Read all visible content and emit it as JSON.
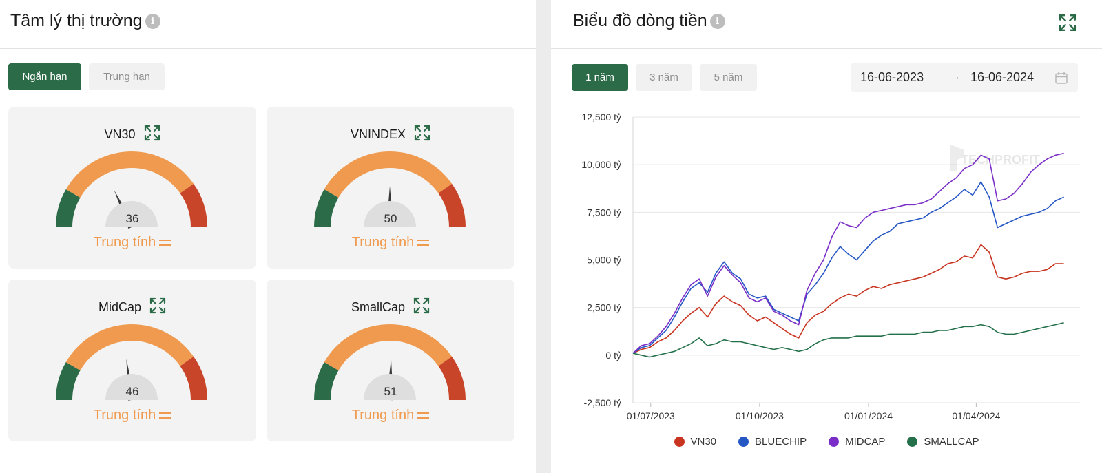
{
  "left": {
    "title": "Tâm lý thị trường",
    "tabs": [
      "Ngắn hạn",
      "Trung hạn"
    ],
    "gauges": [
      {
        "name": "VN30",
        "value": 36,
        "label": "Trung tính"
      },
      {
        "name": "VNINDEX",
        "value": 50,
        "label": "Trung tính"
      },
      {
        "name": "MidCap",
        "value": 46,
        "label": "Trung tính"
      },
      {
        "name": "SmallCap",
        "value": 51,
        "label": "Trung tính"
      }
    ]
  },
  "right": {
    "title": "Biểu đồ dòng tiền",
    "periods": [
      "1 năm",
      "3 năm",
      "5 năm"
    ],
    "date_from": "16-06-2023",
    "date_to": "16-06-2024",
    "date_arrow": "→",
    "watermark": "TECHPROFIT"
  },
  "colors": {
    "green": "#2b6b48",
    "orange": "#ef9a4e",
    "red": "#c8452a",
    "vn30": "#c8341f",
    "bluechip": "#2456c4",
    "midcap": "#7a2ec7",
    "smallcap": "#23704a"
  },
  "chart_data": {
    "type": "line",
    "ylim": [
      -2500,
      12500
    ],
    "yticks": [
      -2500,
      0,
      2500,
      5000,
      7500,
      10000,
      12500
    ],
    "ytick_labels": [
      "-2,500 tỷ",
      "0 tỷ",
      "2,500 tỷ",
      "5,000 tỷ",
      "7,500 tỷ",
      "10,000 tỷ",
      "12,500 tỷ"
    ],
    "xlim": [
      "2023-06-16",
      "2024-06-16"
    ],
    "xticks": [
      "2023-07-01",
      "2023-10-01",
      "2024-01-01",
      "2024-04-01"
    ],
    "xtick_labels": [
      "01/07/2023",
      "01/10/2023",
      "01/01/2024",
      "01/04/2024"
    ],
    "grid": true,
    "legend_position": "bottom",
    "series": [
      {
        "name": "VN30",
        "color": "#c8341f",
        "points": [
          [
            "2023-06-16",
            100
          ],
          [
            "2023-06-23",
            300
          ],
          [
            "2023-06-30",
            400
          ],
          [
            "2023-07-07",
            700
          ],
          [
            "2023-07-14",
            900
          ],
          [
            "2023-07-21",
            1300
          ],
          [
            "2023-07-28",
            1800
          ],
          [
            "2023-08-04",
            2200
          ],
          [
            "2023-08-11",
            2500
          ],
          [
            "2023-08-18",
            2000
          ],
          [
            "2023-08-25",
            2700
          ],
          [
            "2023-09-01",
            3100
          ],
          [
            "2023-09-08",
            2800
          ],
          [
            "2023-09-15",
            2600
          ],
          [
            "2023-09-22",
            2100
          ],
          [
            "2023-09-29",
            1800
          ],
          [
            "2023-10-06",
            2000
          ],
          [
            "2023-10-13",
            1700
          ],
          [
            "2023-10-20",
            1400
          ],
          [
            "2023-10-27",
            1100
          ],
          [
            "2023-11-03",
            900
          ],
          [
            "2023-11-10",
            1700
          ],
          [
            "2023-11-17",
            2100
          ],
          [
            "2023-11-24",
            2300
          ],
          [
            "2023-12-01",
            2700
          ],
          [
            "2023-12-08",
            3000
          ],
          [
            "2023-12-15",
            3200
          ],
          [
            "2023-12-22",
            3100
          ],
          [
            "2023-12-29",
            3400
          ],
          [
            "2024-01-05",
            3600
          ],
          [
            "2024-01-12",
            3500
          ],
          [
            "2024-01-19",
            3700
          ],
          [
            "2024-01-26",
            3800
          ],
          [
            "2024-02-02",
            3900
          ],
          [
            "2024-02-09",
            4000
          ],
          [
            "2024-02-16",
            4100
          ],
          [
            "2024-02-23",
            4300
          ],
          [
            "2024-03-01",
            4500
          ],
          [
            "2024-03-08",
            4800
          ],
          [
            "2024-03-15",
            4900
          ],
          [
            "2024-03-22",
            5200
          ],
          [
            "2024-03-29",
            5100
          ],
          [
            "2024-04-05",
            5800
          ],
          [
            "2024-04-12",
            5400
          ],
          [
            "2024-04-19",
            4100
          ],
          [
            "2024-04-26",
            4000
          ],
          [
            "2024-05-03",
            4100
          ],
          [
            "2024-05-10",
            4300
          ],
          [
            "2024-05-17",
            4400
          ],
          [
            "2024-05-24",
            4400
          ],
          [
            "2024-05-31",
            4500
          ],
          [
            "2024-06-07",
            4800
          ],
          [
            "2024-06-14",
            4800
          ]
        ]
      },
      {
        "name": "BLUECHIP",
        "color": "#2456c4",
        "points": [
          [
            "2023-06-16",
            100
          ],
          [
            "2023-06-23",
            400
          ],
          [
            "2023-06-30",
            500
          ],
          [
            "2023-07-07",
            900
          ],
          [
            "2023-07-14",
            1300
          ],
          [
            "2023-07-21",
            2000
          ],
          [
            "2023-07-28",
            2800
          ],
          [
            "2023-08-04",
            3500
          ],
          [
            "2023-08-11",
            3800
          ],
          [
            "2023-08-18",
            3300
          ],
          [
            "2023-08-25",
            4300
          ],
          [
            "2023-09-01",
            4900
          ],
          [
            "2023-09-08",
            4300
          ],
          [
            "2023-09-15",
            4000
          ],
          [
            "2023-09-22",
            3200
          ],
          [
            "2023-09-29",
            3000
          ],
          [
            "2023-10-06",
            3100
          ],
          [
            "2023-10-13",
            2400
          ],
          [
            "2023-10-20",
            2200
          ],
          [
            "2023-10-27",
            2000
          ],
          [
            "2023-11-03",
            1800
          ],
          [
            "2023-11-10",
            3200
          ],
          [
            "2023-11-17",
            3700
          ],
          [
            "2023-11-24",
            4300
          ],
          [
            "2023-12-01",
            5100
          ],
          [
            "2023-12-08",
            5700
          ],
          [
            "2023-12-15",
            5300
          ],
          [
            "2023-12-22",
            5000
          ],
          [
            "2023-12-29",
            5500
          ],
          [
            "2024-01-05",
            6000
          ],
          [
            "2024-01-12",
            6300
          ],
          [
            "2024-01-19",
            6500
          ],
          [
            "2024-01-26",
            6900
          ],
          [
            "2024-02-02",
            7000
          ],
          [
            "2024-02-09",
            7100
          ],
          [
            "2024-02-16",
            7200
          ],
          [
            "2024-02-23",
            7500
          ],
          [
            "2024-03-01",
            7700
          ],
          [
            "2024-03-08",
            8000
          ],
          [
            "2024-03-15",
            8300
          ],
          [
            "2024-03-22",
            8700
          ],
          [
            "2024-03-29",
            8400
          ],
          [
            "2024-04-05",
            9100
          ],
          [
            "2024-04-12",
            8300
          ],
          [
            "2024-04-19",
            6700
          ],
          [
            "2024-04-26",
            6900
          ],
          [
            "2024-05-03",
            7100
          ],
          [
            "2024-05-10",
            7300
          ],
          [
            "2024-05-17",
            7400
          ],
          [
            "2024-05-24",
            7500
          ],
          [
            "2024-05-31",
            7700
          ],
          [
            "2024-06-07",
            8100
          ],
          [
            "2024-06-14",
            8300
          ]
        ]
      },
      {
        "name": "MIDCAP",
        "color": "#7a2ec7",
        "points": [
          [
            "2023-06-16",
            100
          ],
          [
            "2023-06-23",
            500
          ],
          [
            "2023-06-30",
            600
          ],
          [
            "2023-07-07",
            1000
          ],
          [
            "2023-07-14",
            1500
          ],
          [
            "2023-07-21",
            2200
          ],
          [
            "2023-07-28",
            3000
          ],
          [
            "2023-08-04",
            3700
          ],
          [
            "2023-08-11",
            4000
          ],
          [
            "2023-08-18",
            3100
          ],
          [
            "2023-08-25",
            4100
          ],
          [
            "2023-09-01",
            4700
          ],
          [
            "2023-09-08",
            4200
          ],
          [
            "2023-09-15",
            3800
          ],
          [
            "2023-09-22",
            3000
          ],
          [
            "2023-09-29",
            2800
          ],
          [
            "2023-10-06",
            3000
          ],
          [
            "2023-10-13",
            2300
          ],
          [
            "2023-10-20",
            2100
          ],
          [
            "2023-10-27",
            1800
          ],
          [
            "2023-11-03",
            1600
          ],
          [
            "2023-11-10",
            3400
          ],
          [
            "2023-11-17",
            4300
          ],
          [
            "2023-11-24",
            5000
          ],
          [
            "2023-12-01",
            6200
          ],
          [
            "2023-12-08",
            7000
          ],
          [
            "2023-12-15",
            6800
          ],
          [
            "2023-12-22",
            6700
          ],
          [
            "2023-12-29",
            7200
          ],
          [
            "2024-01-05",
            7500
          ],
          [
            "2024-01-12",
            7600
          ],
          [
            "2024-01-19",
            7700
          ],
          [
            "2024-01-26",
            7800
          ],
          [
            "2024-02-02",
            7900
          ],
          [
            "2024-02-09",
            7900
          ],
          [
            "2024-02-16",
            8000
          ],
          [
            "2024-02-23",
            8200
          ],
          [
            "2024-03-01",
            8600
          ],
          [
            "2024-03-08",
            9000
          ],
          [
            "2024-03-15",
            9300
          ],
          [
            "2024-03-22",
            9800
          ],
          [
            "2024-03-29",
            10000
          ],
          [
            "2024-04-05",
            10500
          ],
          [
            "2024-04-12",
            10300
          ],
          [
            "2024-04-19",
            8100
          ],
          [
            "2024-04-26",
            8200
          ],
          [
            "2024-05-03",
            8500
          ],
          [
            "2024-05-10",
            9000
          ],
          [
            "2024-05-17",
            9600
          ],
          [
            "2024-05-24",
            10000
          ],
          [
            "2024-05-31",
            10300
          ],
          [
            "2024-06-07",
            10500
          ],
          [
            "2024-06-14",
            10600
          ]
        ]
      },
      {
        "name": "SMALLCAP",
        "color": "#23704a",
        "points": [
          [
            "2023-06-16",
            100
          ],
          [
            "2023-06-23",
            0
          ],
          [
            "2023-06-30",
            -100
          ],
          [
            "2023-07-07",
            0
          ],
          [
            "2023-07-14",
            100
          ],
          [
            "2023-07-21",
            200
          ],
          [
            "2023-07-28",
            400
          ],
          [
            "2023-08-04",
            600
          ],
          [
            "2023-08-11",
            900
          ],
          [
            "2023-08-18",
            500
          ],
          [
            "2023-08-25",
            600
          ],
          [
            "2023-09-01",
            800
          ],
          [
            "2023-09-08",
            700
          ],
          [
            "2023-09-15",
            700
          ],
          [
            "2023-09-22",
            600
          ],
          [
            "2023-09-29",
            500
          ],
          [
            "2023-10-06",
            400
          ],
          [
            "2023-10-13",
            300
          ],
          [
            "2023-10-20",
            400
          ],
          [
            "2023-10-27",
            300
          ],
          [
            "2023-11-03",
            200
          ],
          [
            "2023-11-10",
            300
          ],
          [
            "2023-11-17",
            600
          ],
          [
            "2023-11-24",
            800
          ],
          [
            "2023-12-01",
            900
          ],
          [
            "2023-12-08",
            900
          ],
          [
            "2023-12-15",
            900
          ],
          [
            "2023-12-22",
            1000
          ],
          [
            "2023-12-29",
            1000
          ],
          [
            "2024-01-05",
            1000
          ],
          [
            "2024-01-12",
            1000
          ],
          [
            "2024-01-19",
            1100
          ],
          [
            "2024-01-26",
            1100
          ],
          [
            "2024-02-02",
            1100
          ],
          [
            "2024-02-09",
            1100
          ],
          [
            "2024-02-16",
            1200
          ],
          [
            "2024-02-23",
            1200
          ],
          [
            "2024-03-01",
            1300
          ],
          [
            "2024-03-08",
            1300
          ],
          [
            "2024-03-15",
            1400
          ],
          [
            "2024-03-22",
            1500
          ],
          [
            "2024-03-29",
            1500
          ],
          [
            "2024-04-05",
            1600
          ],
          [
            "2024-04-12",
            1500
          ],
          [
            "2024-04-19",
            1200
          ],
          [
            "2024-04-26",
            1100
          ],
          [
            "2024-05-03",
            1100
          ],
          [
            "2024-05-10",
            1200
          ],
          [
            "2024-05-17",
            1300
          ],
          [
            "2024-05-24",
            1400
          ],
          [
            "2024-05-31",
            1500
          ],
          [
            "2024-06-07",
            1600
          ],
          [
            "2024-06-14",
            1700
          ]
        ]
      }
    ]
  }
}
